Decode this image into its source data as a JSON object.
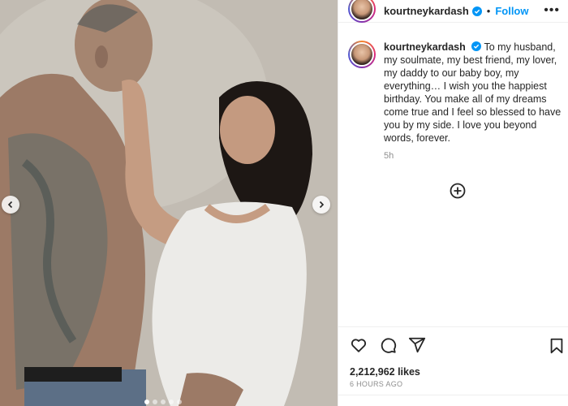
{
  "post": {
    "username": "kourtneykardash",
    "follow_label": "Follow",
    "separator": "•",
    "more_label": "•••",
    "caption": "To my husband, my soulmate, my best friend, my lover, my daddy to our baby boy, my everything… I wish you the happiest birthday. You make all of my dreams come true and I feel so blessed to have you by my side. I love you beyond words, forever.",
    "caption_age": "5h",
    "likes": "2,212,962 likes",
    "posted_ago": "6 HOURS AGO",
    "carousel": {
      "current": 1,
      "total": 5
    }
  },
  "icons": {
    "verified": "verified-badge-icon",
    "prev": "chevron-left-icon",
    "next": "chevron-right-icon",
    "add": "add-circle-icon",
    "like": "heart-icon",
    "comment": "comment-icon",
    "share": "paper-plane-icon",
    "save": "bookmark-icon"
  },
  "colors": {
    "accent": "#0095f6",
    "text": "#262626",
    "muted": "#8e8e8e",
    "border": "#efefef"
  }
}
